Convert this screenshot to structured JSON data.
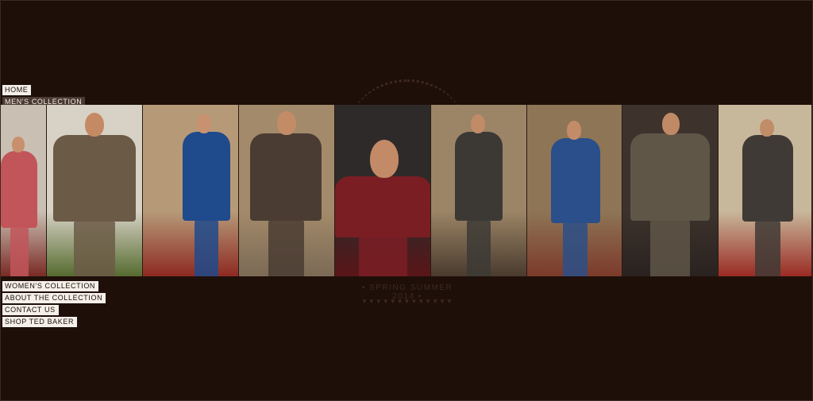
{
  "nav_top": [
    {
      "label": "HOME",
      "active": false
    },
    {
      "label": "MEN'S COLLECTION",
      "active": true
    }
  ],
  "nav_bottom": [
    {
      "label": "WOMEN'S COLLECTION"
    },
    {
      "label": "ABOUT THE COLLECTION"
    },
    {
      "label": "CONTACT US"
    },
    {
      "label": "SHOP TED BAKER"
    }
  ],
  "season_text": "• SPRING SUMMER 2014 •",
  "season_triangles": "▼▼▼▼▼▼▼▼▼▼▼▼▼",
  "colors": {
    "page_bg": "#1e0f09",
    "nav_bg": "#f4efe8",
    "nav_active_bg": "#4a3a32"
  },
  "panels": [
    {
      "name": "panel-pink-blazer",
      "bg": "#c9c0b3",
      "suit": "#c2555a",
      "skin": "#c8906d",
      "floor": "#7a2a25"
    },
    {
      "name": "panel-check-jacket",
      "bg": "#d8d2c6",
      "suit": "#6b5a45",
      "skin": "#c48a64",
      "floor": "#556b2f"
    },
    {
      "name": "panel-couple",
      "bg": "#b69a78",
      "suit": "#1f4a8c",
      "skin": "#c89270",
      "floor": "#8e2a22"
    },
    {
      "name": "panel-tweed-jacket",
      "bg": "#a38a6a",
      "suit": "#4a3c33",
      "skin": "#c48c66",
      "floor": "#7c6a55"
    },
    {
      "name": "panel-paisley-closeup",
      "bg": "#2e2a2a",
      "suit": "#7a1e24",
      "skin": "#c28a66",
      "floor": "#5a1518"
    },
    {
      "name": "panel-grey-suit",
      "bg": "#9c8466",
      "suit": "#3c3935",
      "skin": "#c18b67",
      "floor": "#4a3b2e"
    },
    {
      "name": "panel-blue-smoke",
      "bg": "#8e7556",
      "suit": "#2a4f8a",
      "skin": "#c38c68",
      "floor": "#7c3a2a"
    },
    {
      "name": "panel-check-double",
      "bg": "#3d332c",
      "suit": "#5f5648",
      "skin": "#c08a66",
      "floor": "#2a2220"
    },
    {
      "name": "panel-brown-suit",
      "bg": "#c8b89b",
      "suit": "#3f3a35",
      "skin": "#c18c68",
      "floor": "#9a2b24"
    }
  ]
}
